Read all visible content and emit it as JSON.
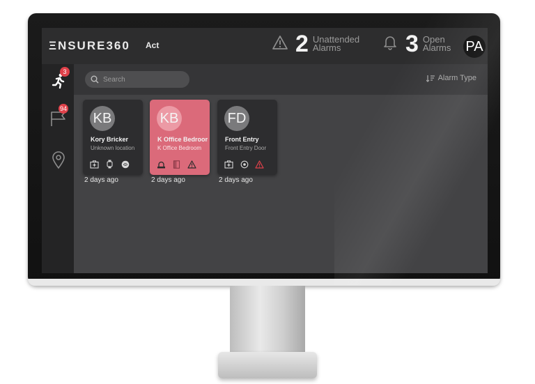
{
  "app": {
    "logo": "ΞNSURE360",
    "module": "Act"
  },
  "header": {
    "unattended": {
      "count": "2",
      "label_line1": "Unattended",
      "label_line2": "Alarms"
    },
    "open": {
      "count": "3",
      "label_line1": "Open",
      "label_line2": "Alarms"
    },
    "user_initials": "PA"
  },
  "sidebar": {
    "items": [
      {
        "name": "running-person-icon",
        "badge": "3"
      },
      {
        "name": "flag-icon",
        "badge": "94"
      },
      {
        "name": "location-pin-icon",
        "badge": ""
      }
    ]
  },
  "toolbar": {
    "search_placeholder": "Search",
    "sort_label": "Alarm Type"
  },
  "cards": [
    {
      "initials": "KB",
      "name": "Kory Bricker",
      "location": "Unknown location",
      "time": "2 days ago",
      "highlighted": false
    },
    {
      "initials": "KB",
      "name": "K Office Bedroom",
      "location": "K Office Bedroom",
      "time": "2 days ago",
      "highlighted": true
    },
    {
      "initials": "FD",
      "name": "Front Entry",
      "location": "Front Entry Door",
      "time": "2 days ago",
      "highlighted": false
    }
  ],
  "colors": {
    "accent_red": "#e0414a",
    "card_red": "#db6a7a",
    "screen_bg": "#434345"
  }
}
